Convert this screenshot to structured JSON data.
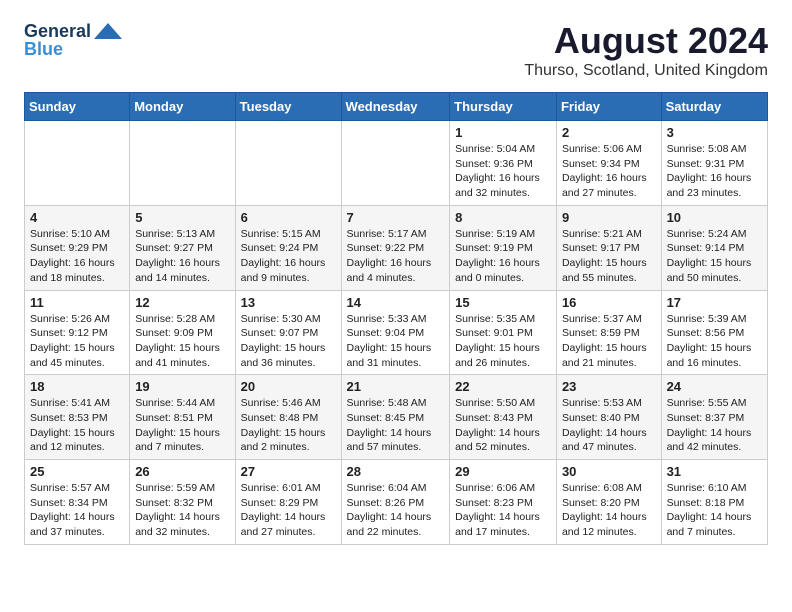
{
  "logo": {
    "general": "General",
    "blue": "Blue"
  },
  "title": "August 2024",
  "location": "Thurso, Scotland, United Kingdom",
  "days_header": [
    "Sunday",
    "Monday",
    "Tuesday",
    "Wednesday",
    "Thursday",
    "Friday",
    "Saturday"
  ],
  "weeks": [
    [
      {
        "day": "",
        "info": ""
      },
      {
        "day": "",
        "info": ""
      },
      {
        "day": "",
        "info": ""
      },
      {
        "day": "",
        "info": ""
      },
      {
        "day": "1",
        "info": "Sunrise: 5:04 AM\nSunset: 9:36 PM\nDaylight: 16 hours and 32 minutes."
      },
      {
        "day": "2",
        "info": "Sunrise: 5:06 AM\nSunset: 9:34 PM\nDaylight: 16 hours and 27 minutes."
      },
      {
        "day": "3",
        "info": "Sunrise: 5:08 AM\nSunset: 9:31 PM\nDaylight: 16 hours and 23 minutes."
      }
    ],
    [
      {
        "day": "4",
        "info": "Sunrise: 5:10 AM\nSunset: 9:29 PM\nDaylight: 16 hours and 18 minutes."
      },
      {
        "day": "5",
        "info": "Sunrise: 5:13 AM\nSunset: 9:27 PM\nDaylight: 16 hours and 14 minutes."
      },
      {
        "day": "6",
        "info": "Sunrise: 5:15 AM\nSunset: 9:24 PM\nDaylight: 16 hours and 9 minutes."
      },
      {
        "day": "7",
        "info": "Sunrise: 5:17 AM\nSunset: 9:22 PM\nDaylight: 16 hours and 4 minutes."
      },
      {
        "day": "8",
        "info": "Sunrise: 5:19 AM\nSunset: 9:19 PM\nDaylight: 16 hours and 0 minutes."
      },
      {
        "day": "9",
        "info": "Sunrise: 5:21 AM\nSunset: 9:17 PM\nDaylight: 15 hours and 55 minutes."
      },
      {
        "day": "10",
        "info": "Sunrise: 5:24 AM\nSunset: 9:14 PM\nDaylight: 15 hours and 50 minutes."
      }
    ],
    [
      {
        "day": "11",
        "info": "Sunrise: 5:26 AM\nSunset: 9:12 PM\nDaylight: 15 hours and 45 minutes."
      },
      {
        "day": "12",
        "info": "Sunrise: 5:28 AM\nSunset: 9:09 PM\nDaylight: 15 hours and 41 minutes."
      },
      {
        "day": "13",
        "info": "Sunrise: 5:30 AM\nSunset: 9:07 PM\nDaylight: 15 hours and 36 minutes."
      },
      {
        "day": "14",
        "info": "Sunrise: 5:33 AM\nSunset: 9:04 PM\nDaylight: 15 hours and 31 minutes."
      },
      {
        "day": "15",
        "info": "Sunrise: 5:35 AM\nSunset: 9:01 PM\nDaylight: 15 hours and 26 minutes."
      },
      {
        "day": "16",
        "info": "Sunrise: 5:37 AM\nSunset: 8:59 PM\nDaylight: 15 hours and 21 minutes."
      },
      {
        "day": "17",
        "info": "Sunrise: 5:39 AM\nSunset: 8:56 PM\nDaylight: 15 hours and 16 minutes."
      }
    ],
    [
      {
        "day": "18",
        "info": "Sunrise: 5:41 AM\nSunset: 8:53 PM\nDaylight: 15 hours and 12 minutes."
      },
      {
        "day": "19",
        "info": "Sunrise: 5:44 AM\nSunset: 8:51 PM\nDaylight: 15 hours and 7 minutes."
      },
      {
        "day": "20",
        "info": "Sunrise: 5:46 AM\nSunset: 8:48 PM\nDaylight: 15 hours and 2 minutes."
      },
      {
        "day": "21",
        "info": "Sunrise: 5:48 AM\nSunset: 8:45 PM\nDaylight: 14 hours and 57 minutes."
      },
      {
        "day": "22",
        "info": "Sunrise: 5:50 AM\nSunset: 8:43 PM\nDaylight: 14 hours and 52 minutes."
      },
      {
        "day": "23",
        "info": "Sunrise: 5:53 AM\nSunset: 8:40 PM\nDaylight: 14 hours and 47 minutes."
      },
      {
        "day": "24",
        "info": "Sunrise: 5:55 AM\nSunset: 8:37 PM\nDaylight: 14 hours and 42 minutes."
      }
    ],
    [
      {
        "day": "25",
        "info": "Sunrise: 5:57 AM\nSunset: 8:34 PM\nDaylight: 14 hours and 37 minutes."
      },
      {
        "day": "26",
        "info": "Sunrise: 5:59 AM\nSunset: 8:32 PM\nDaylight: 14 hours and 32 minutes."
      },
      {
        "day": "27",
        "info": "Sunrise: 6:01 AM\nSunset: 8:29 PM\nDaylight: 14 hours and 27 minutes."
      },
      {
        "day": "28",
        "info": "Sunrise: 6:04 AM\nSunset: 8:26 PM\nDaylight: 14 hours and 22 minutes."
      },
      {
        "day": "29",
        "info": "Sunrise: 6:06 AM\nSunset: 8:23 PM\nDaylight: 14 hours and 17 minutes."
      },
      {
        "day": "30",
        "info": "Sunrise: 6:08 AM\nSunset: 8:20 PM\nDaylight: 14 hours and 12 minutes."
      },
      {
        "day": "31",
        "info": "Sunrise: 6:10 AM\nSunset: 8:18 PM\nDaylight: 14 hours and 7 minutes."
      }
    ]
  ]
}
